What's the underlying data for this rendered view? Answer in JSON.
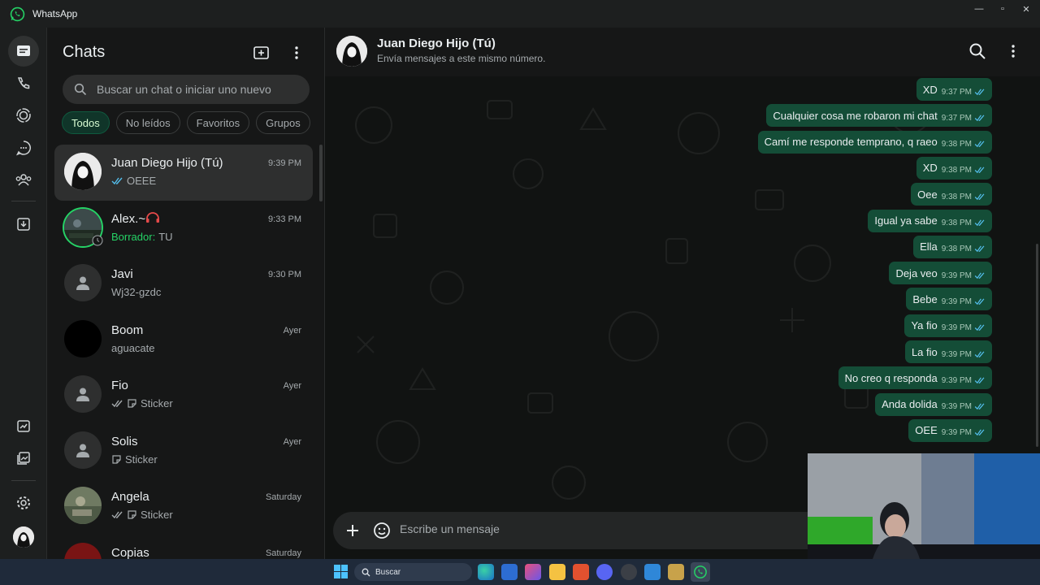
{
  "window": {
    "title": "WhatsApp",
    "minimize_icon": "minimize-icon",
    "maximize_icon": "maximize-icon",
    "close_icon": "close-icon"
  },
  "rail": {
    "items": [
      {
        "name": "chats",
        "icon": "chats-icon",
        "active": true
      },
      {
        "name": "calls",
        "icon": "phone-icon",
        "active": false
      },
      {
        "name": "status",
        "icon": "status-icon",
        "active": false
      },
      {
        "name": "channels",
        "icon": "channels-icon",
        "active": false
      },
      {
        "name": "communities",
        "icon": "communities-icon",
        "active": false
      },
      {
        "name": "archived",
        "icon": "archive-icon",
        "active": false
      },
      {
        "name": "starred",
        "icon": "starred-icon",
        "active": false
      },
      {
        "name": "media",
        "icon": "media-icon",
        "active": false
      },
      {
        "name": "settings",
        "icon": "gear-icon",
        "active": false
      }
    ]
  },
  "chatlist": {
    "title": "Chats",
    "search_placeholder": "Buscar un chat o iniciar uno nuevo",
    "filters": [
      "Todos",
      "No leídos",
      "Favoritos",
      "Grupos"
    ],
    "active_filter": "Todos",
    "chats": [
      {
        "name": "Juan Diego Hijo (Tú)",
        "time": "9:39 PM",
        "preview": "OEEE",
        "ticks": "read",
        "selected": true
      },
      {
        "name": "Alex.~",
        "time": "9:33 PM",
        "draft_label": "Borrador:",
        "preview": "TU",
        "status_ring": true
      },
      {
        "name": "Javi",
        "time": "9:30 PM",
        "preview": "Wj32-gzdc"
      },
      {
        "name": "Boom",
        "time": "Ayer",
        "preview": "aguacate"
      },
      {
        "name": "Fio",
        "time": "Ayer",
        "preview": "Sticker",
        "ticks": "sent",
        "sticker": true
      },
      {
        "name": "Solis",
        "time": "Ayer",
        "preview": "Sticker",
        "sticker": true
      },
      {
        "name": "Angela",
        "time": "Saturday",
        "preview": "Sticker",
        "ticks": "sent",
        "sticker": true
      },
      {
        "name": "Copias",
        "time": "Saturday",
        "preview": ""
      }
    ]
  },
  "conversation": {
    "title": "Juan Diego Hijo (Tú)",
    "subtitle": "Envía mensajes a este mismo número.",
    "messages": [
      {
        "text": "XD",
        "time": "9:37 PM"
      },
      {
        "text": "Cualquier cosa me robaron mi chat",
        "time": "9:37 PM"
      },
      {
        "text": "Camí me responde temprano, q raeo",
        "time": "9:38 PM"
      },
      {
        "text": "XD",
        "time": "9:38 PM"
      },
      {
        "text": "Oee",
        "time": "9:38 PM"
      },
      {
        "text": "Igual ya sabe",
        "time": "9:38 PM"
      },
      {
        "text": "Ella",
        "time": "9:38 PM"
      },
      {
        "text": "Deja veo",
        "time": "9:39 PM"
      },
      {
        "text": "Bebe",
        "time": "9:39 PM"
      },
      {
        "text": "Ya fio",
        "time": "9:39 PM"
      },
      {
        "text": "La fio",
        "time": "9:39 PM"
      },
      {
        "text": "No creo q responda",
        "time": "9:39 PM"
      },
      {
        "text": "Anda dolida",
        "time": "9:39 PM"
      },
      {
        "text": "OEE",
        "time": "9:39 PM"
      }
    ],
    "composer_placeholder": "Escribe un mensaje"
  },
  "taskbar": {
    "search_label": "Buscar"
  },
  "colors": {
    "accent": "#25d366",
    "bubble_out": "#144d37",
    "tick_read": "#53bdeb",
    "background": "#161717"
  }
}
